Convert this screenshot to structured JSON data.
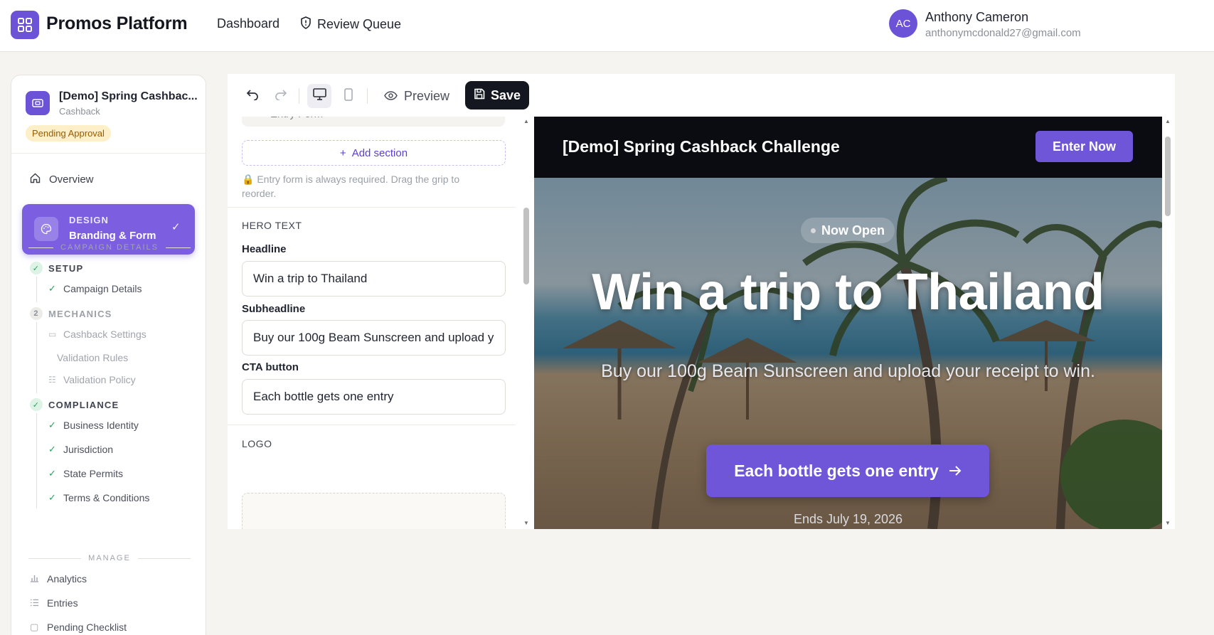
{
  "app": {
    "name": "Promos Platform"
  },
  "nav": {
    "dashboard": "Dashboard",
    "review_queue": "Review Queue"
  },
  "user": {
    "initials": "AC",
    "name": "Anthony Cameron",
    "email": "anthonymcdonald27@gmail.com"
  },
  "campaign": {
    "title": "[Demo] Spring Cashbac...",
    "type": "Cashback",
    "status": "Pending Approval"
  },
  "sidebar": {
    "overview": "Overview",
    "design": {
      "over": "DESIGN",
      "title": "Branding & Form"
    },
    "campaign_details_divider": "CAMPAIGN DETAILS",
    "setup": {
      "label": "SETUP",
      "items": [
        "Campaign Details"
      ]
    },
    "mechanics": {
      "step": "2",
      "label": "MECHANICS",
      "items": [
        "Cashback Settings",
        "Validation Rules",
        "Validation Policy"
      ]
    },
    "compliance": {
      "label": "COMPLIANCE",
      "items": [
        "Business Identity",
        "Jurisdiction",
        "State Permits",
        "Terms & Conditions"
      ]
    },
    "manage_divider": "MANAGE",
    "manage": [
      "Analytics",
      "Entries",
      "Pending Checklist"
    ]
  },
  "toolbar": {
    "preview": "Preview",
    "save": "Save"
  },
  "form": {
    "entry_stub": "Entry Form",
    "add_section": "Add section",
    "note": "Entry form is always required. Drag the grip to reorder.",
    "hero_section": "HERO TEXT",
    "headline_label": "Headline",
    "headline_value": "Win a trip to Thailand",
    "subheadline_label": "Subheadline",
    "subheadline_value": "Buy our 100g Beam Sunscreen and upload your receipt to win.",
    "cta_label": "CTA button",
    "cta_value": "Each bottle gets one entry",
    "logo_section": "LOGO"
  },
  "preview": {
    "header_title": "[Demo] Spring Cashback Challenge",
    "enter_button": "Enter Now",
    "badge": "Now Open",
    "headline": "Win a trip to Thailand",
    "subheadline": "Buy our 100g Beam Sunscreen and upload your receipt to win.",
    "cta": "Each bottle gets one entry",
    "ends": "Ends July 19, 2026"
  },
  "colors": {
    "brand": "#6c52d6",
    "cta": "#6f55d8",
    "save": "#14171f",
    "success": "#2f9e62",
    "warning_bg": "#fdf0c9"
  }
}
